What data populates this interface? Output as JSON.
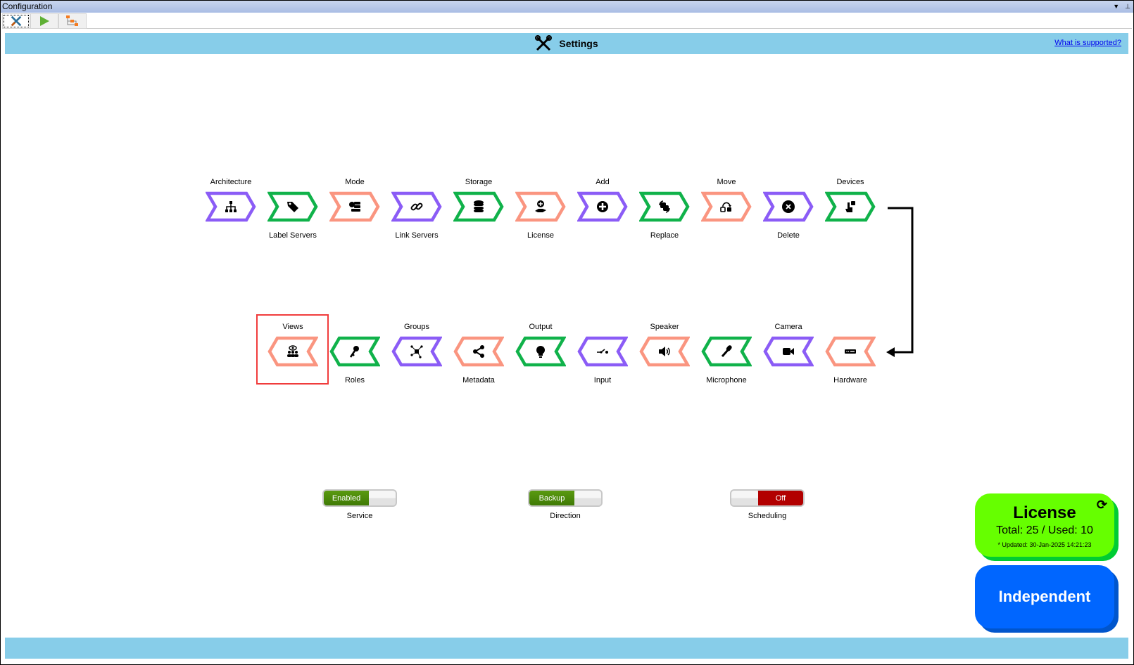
{
  "window": {
    "title": "Configuration"
  },
  "tabs": [
    {
      "name": "settings",
      "icon": "tools-icon"
    },
    {
      "name": "run",
      "icon": "play-icon"
    },
    {
      "name": "flow",
      "icon": "flow-icon"
    }
  ],
  "header": {
    "title": "Settings",
    "icon": "tools-icon",
    "help_link": "What is supported?"
  },
  "colors": {
    "purple": "#8b5cf6",
    "green": "#10b24a",
    "salmon": "#fa9580",
    "header": "#87cde9",
    "license": "#66ff00",
    "independent": "#0066ff"
  },
  "row1": [
    {
      "label": "Architecture",
      "color": "purple",
      "icon": "sitemap"
    },
    {
      "label": "Label Servers",
      "color": "green",
      "icon": "tag"
    },
    {
      "label": "Mode",
      "color": "salmon",
      "icon": "server-gear"
    },
    {
      "label": "Link Servers",
      "color": "purple",
      "icon": "link"
    },
    {
      "label": "Storage",
      "color": "green",
      "icon": "database"
    },
    {
      "label": "License",
      "color": "salmon",
      "icon": "hand-plus"
    },
    {
      "label": "Add",
      "color": "purple",
      "icon": "plus-circle"
    },
    {
      "label": "Replace",
      "color": "green",
      "icon": "replace"
    },
    {
      "label": "Move",
      "color": "salmon",
      "icon": "move"
    },
    {
      "label": "Delete",
      "color": "purple",
      "icon": "x-circle"
    },
    {
      "label": "Devices",
      "color": "green",
      "icon": "hand-pointer"
    }
  ],
  "row2": [
    {
      "label": "Views",
      "color": "salmon",
      "icon": "views",
      "selected": true
    },
    {
      "label": "Roles",
      "color": "green",
      "icon": "keys"
    },
    {
      "label": "Groups",
      "color": "purple",
      "icon": "groups"
    },
    {
      "label": "Metadata",
      "color": "salmon",
      "icon": "share-nodes"
    },
    {
      "label": "Output",
      "color": "green",
      "icon": "lightbulb"
    },
    {
      "label": "Input",
      "color": "purple",
      "icon": "switch"
    },
    {
      "label": "Speaker",
      "color": "salmon",
      "icon": "volume"
    },
    {
      "label": "Microphone",
      "color": "green",
      "icon": "microphone"
    },
    {
      "label": "Camera",
      "color": "purple",
      "icon": "video"
    },
    {
      "label": "Hardware",
      "color": "salmon",
      "icon": "hardware"
    }
  ],
  "toggles": [
    {
      "label": "Service",
      "state_text": "Enabled",
      "on": true
    },
    {
      "label": "Direction",
      "state_text": "Backup",
      "on": true
    },
    {
      "label": "Scheduling",
      "state_text": "Off",
      "on": false
    }
  ],
  "license": {
    "title": "License",
    "total_used": "Total: 25 / Used: 10",
    "updated": "* Updated: 30-Jan-2025 14:21:23",
    "refresh_icon": "refresh-icon"
  },
  "mode_card": {
    "label": "Independent"
  }
}
